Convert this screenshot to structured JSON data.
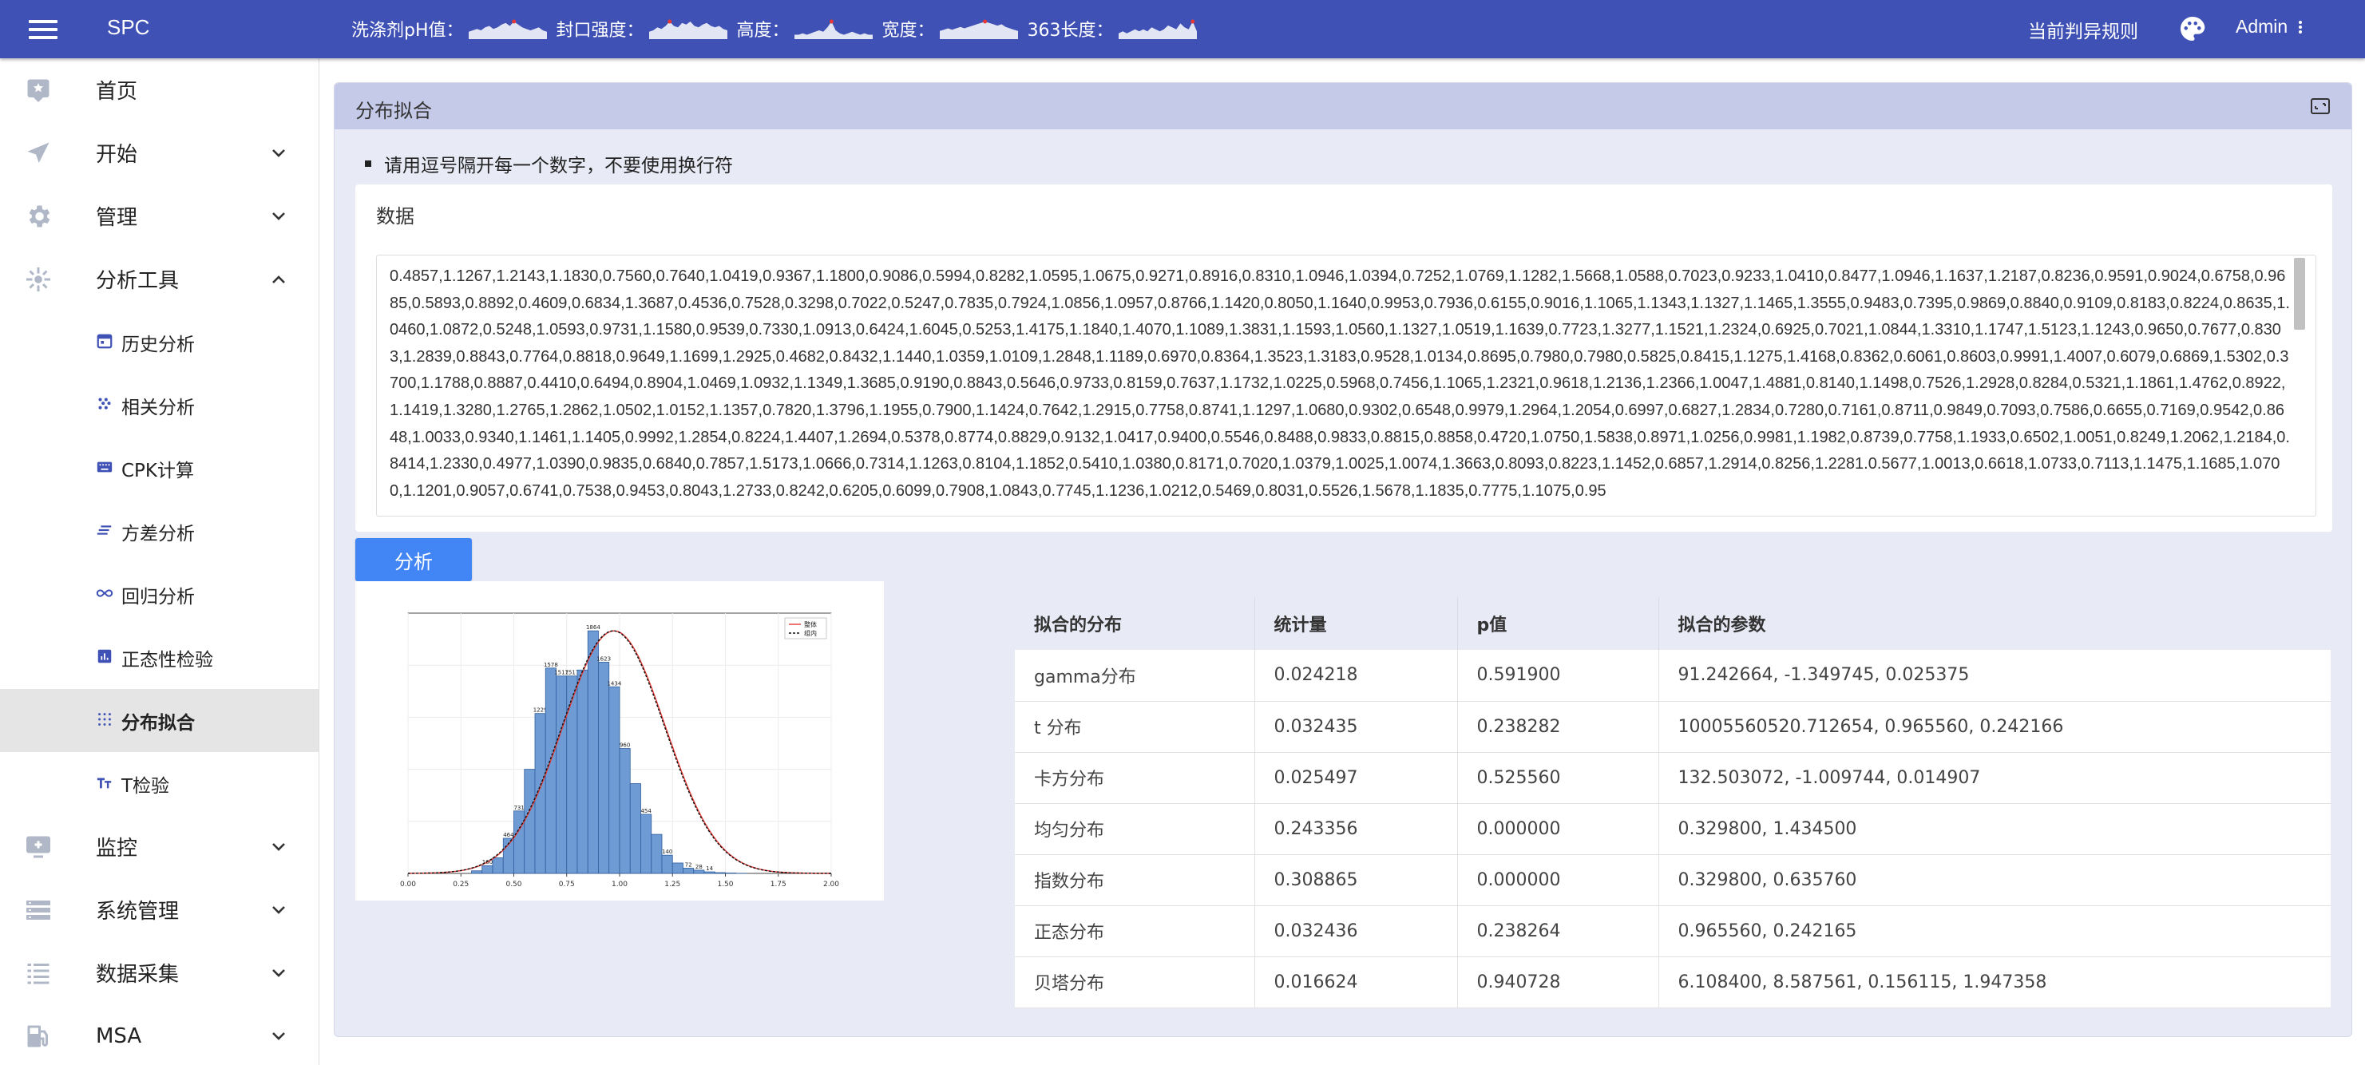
{
  "app": {
    "title": "SPC"
  },
  "metrics": [
    {
      "label": "洗涤剂pH值：",
      "spark": [
        5,
        6,
        7,
        6,
        8,
        9,
        7,
        8,
        10,
        11,
        9,
        12,
        10,
        8,
        7,
        6,
        7,
        8,
        6,
        5
      ]
    },
    {
      "label": "封口强度：",
      "spark": [
        5,
        6,
        8,
        7,
        9,
        12,
        9,
        8,
        11,
        10,
        12,
        9,
        8,
        10,
        11,
        9,
        8,
        9,
        7,
        6
      ]
    },
    {
      "label": "高度：",
      "spark": [
        3,
        3,
        4,
        3,
        4,
        5,
        6,
        5,
        8,
        12,
        6,
        4,
        3,
        4,
        5,
        4,
        3,
        4,
        3,
        3
      ]
    },
    {
      "label": "宽度：",
      "spark": [
        6,
        7,
        8,
        7,
        8,
        9,
        8,
        9,
        10,
        11,
        12,
        13,
        12,
        11,
        10,
        11,
        9,
        8,
        7,
        6
      ]
    },
    {
      "label": "363长度：",
      "spark": [
        3,
        4,
        3,
        4,
        5,
        4,
        5,
        4,
        6,
        5,
        4,
        5,
        7,
        6,
        5,
        8,
        6,
        5,
        9,
        4
      ]
    }
  ],
  "header_right": {
    "rules": "当前判异规则",
    "user": "Admin"
  },
  "sidebar": {
    "items": [
      {
        "label": "首页"
      },
      {
        "label": "开始"
      },
      {
        "label": "管理"
      },
      {
        "label": "分析工具"
      }
    ],
    "sub_items": [
      {
        "label": "历史分析"
      },
      {
        "label": "相关分析"
      },
      {
        "label": "CPK计算"
      },
      {
        "label": "方差分析"
      },
      {
        "label": "回归分析"
      },
      {
        "label": "正态性检验"
      },
      {
        "label": "分布拟合"
      },
      {
        "label": "T检验"
      }
    ],
    "items_after": [
      {
        "label": "监控"
      },
      {
        "label": "系统管理"
      },
      {
        "label": "数据采集"
      },
      {
        "label": "MSA"
      }
    ]
  },
  "card": {
    "title": "分布拟合",
    "instruction": "请用逗号隔开每一个数字，不要使用换行符",
    "data_label": "数据",
    "data_value": "0.4857,1.1267,1.2143,1.1830,0.7560,0.7640,1.0419,0.9367,1.1800,0.9086,0.5994,0.8282,1.0595,1.0675,0.9271,0.8916,0.8310,1.0946,1.0394,0.7252,1.0769,1.1282,1.5668,1.0588,0.7023,0.9233,1.0410,0.8477,1.0946,1.1637,1.2187,0.8236,0.9591,0.9024,0.6758,0.9685,0.5893,0.8892,0.4609,0.6834,1.3687,0.4536,0.7528,0.3298,0.7022,0.5247,0.7835,0.7924,1.0856,1.0957,0.8766,1.1420,0.8050,1.1640,0.9953,0.7936,0.6155,0.9016,1.1065,1.1343,1.1327,1.1465,1.3555,0.9483,0.7395,0.9869,0.8840,0.9109,0.8183,0.8224,0.8635,1.0460,1.0872,0.5248,1.0593,0.9731,1.1580,0.9539,0.7330,1.0913,0.6424,1.6045,0.5253,1.4175,1.1840,1.4070,1.1089,1.3831,1.1593,1.0560,1.1327,1.0519,1.1639,0.7723,1.3277,1.1521,1.2324,0.6925,0.7021,1.0844,1.3310,1.1747,1.5123,1.1243,0.9650,0.7677,0.8303,1.2839,0.8843,0.7764,0.8818,0.9649,1.1699,1.2925,0.4682,0.8432,1.1440,1.0359,1.0109,1.2848,1.1189,0.6970,0.8364,1.3523,1.3183,0.9528,1.0134,0.8695,0.7980,0.7980,0.5825,0.8415,1.1275,1.4168,0.8362,0.6061,0.8603,0.9991,1.4007,0.6079,0.6869,1.5302,0.3700,1.1788,0.8887,0.4410,0.6494,0.8904,1.0469,1.0932,1.1349,1.3685,0.9190,0.8843,0.5646,0.9733,0.8159,0.7637,1.1732,1.0225,0.5968,0.7456,1.1065,1.2321,0.9618,1.2136,1.2366,1.0047,1.4881,0.8140,1.1498,0.7526,1.2928,0.8284,0.5321,1.1861,1.4762,0.8922,1.1419,1.3280,1.2765,1.2862,1.0502,1.0152,1.1357,0.7820,1.3796,1.1955,0.7900,1.1424,0.7642,1.2915,0.7758,0.8741,1.1297,1.0680,0.9302,0.6548,0.9979,1.2964,1.2054,0.6997,0.6827,1.2834,0.7280,0.7161,0.8711,0.9849,0.7093,0.7586,0.6655,0.7169,0.9542,0.8648,1.0033,0.9340,1.1461,1.1405,0.9992,1.2854,0.8224,1.4407,1.2694,0.5378,0.8774,0.8829,0.9132,1.0417,0.9400,0.5546,0.8488,0.9833,0.8815,0.8858,0.4720,1.0750,1.5838,0.8971,1.0256,0.9981,1.1982,0.8739,0.7758,1.1933,0.6502,1.0051,0.8249,1.2062,1.2184,0.8414,1.2330,0.4977,1.0390,0.9835,0.6840,0.7857,1.5173,1.0666,0.7314,1.1263,0.8104,1.1852,0.5410,1.0380,0.8171,0.7020,1.0379,1.0025,1.0074,1.3663,0.8093,0.8223,1.1452,0.6857,1.2914,0.8256,1.2281.0.5677,1.0013,0.6618,1.0733,0.7113,1.1475,1.1685,1.0700,1.1201,0.9057,0.6741,0.7538,0.9453,0.8043,1.2733,0.8242,0.6205,0.6099,0.7908,1.0843,0.7745,1.1236,1.0212,0.5469,0.8031,0.5526,1.5678,1.1835,0.7775,1.1075,0.95",
    "analyze_label": "分析"
  },
  "chart_data": {
    "type": "bar",
    "title": "",
    "xlabel": "",
    "ylabel": "",
    "xlim": [
      0,
      2
    ],
    "x_ticks": [
      "0.00",
      "0.25",
      "0.50",
      "0.75",
      "1.00",
      "1.25",
      "1.50",
      "1.75",
      "2.00"
    ],
    "bin_edges": [
      0.3,
      0.35,
      0.4,
      0.45,
      0.5,
      0.55,
      0.6,
      0.65,
      0.7,
      0.75,
      0.8,
      0.85,
      0.9,
      0.95,
      1.0,
      1.05,
      1.1,
      1.15,
      1.2,
      1.25,
      1.3,
      1.35,
      1.4,
      1.45,
      1.5,
      1.55,
      1.6,
      1.65,
      1.7
    ],
    "values": [
      20,
      60,
      120,
      270,
      480,
      800,
      1229,
      1578,
      1517,
      1517,
      1563,
      1864,
      1623,
      1434,
      960,
      690,
      454,
      300,
      140,
      80,
      40,
      25,
      12,
      6,
      3,
      1,
      0,
      0
    ],
    "bar_labels": [
      "",
      "160",
      "",
      "464",
      "731",
      "",
      "1229",
      "1578",
      "1517",
      "1517",
      "",
      "1864",
      "1623",
      "1434",
      "960",
      "",
      "454",
      "",
      "140",
      "",
      "72",
      "28",
      "14",
      "",
      "",
      "",
      "",
      ""
    ],
    "curve": {
      "mean": 0.97,
      "sd": 0.242
    },
    "legend": {
      "position": "top-right",
      "entries": [
        "整体",
        "组内"
      ]
    },
    "colors": {
      "bar": "#6f9bd4",
      "bar_edge": "#2f5f9f",
      "curve_a": "#e53935",
      "curve_b": "#111111"
    }
  },
  "results": {
    "headers": [
      "拟合的分布",
      "统计量",
      "p值",
      "拟合的参数"
    ],
    "rows": [
      [
        "gamma分布",
        "0.024218",
        "0.591900",
        "91.242664, -1.349745, 0.025375"
      ],
      [
        "t 分布",
        "0.032435",
        "0.238282",
        "10005560520.712654, 0.965560, 0.242166"
      ],
      [
        "卡方分布",
        "0.025497",
        "0.525560",
        "132.503072, -1.009744, 0.014907"
      ],
      [
        "均匀分布",
        "0.243356",
        "0.000000",
        "0.329800, 1.434500"
      ],
      [
        "指数分布",
        "0.308865",
        "0.000000",
        "0.329800, 0.635760"
      ],
      [
        "正态分布",
        "0.032436",
        "0.238264",
        "0.965560, 0.242165"
      ],
      [
        "贝塔分布",
        "0.016624",
        "0.940728",
        "6.108400, 8.587561, 0.156115, 1.947358"
      ]
    ]
  },
  "colors": {
    "primary": "#3f51b5",
    "card_header": "#c5cae9",
    "card_bg": "#e8eaf6",
    "button": "#4285f4",
    "sidebar_active": "#e5e5e5",
    "icon_gray": "#b0b8c8",
    "spark_fill": "#ffffff",
    "spark_mark": "#e53935"
  }
}
